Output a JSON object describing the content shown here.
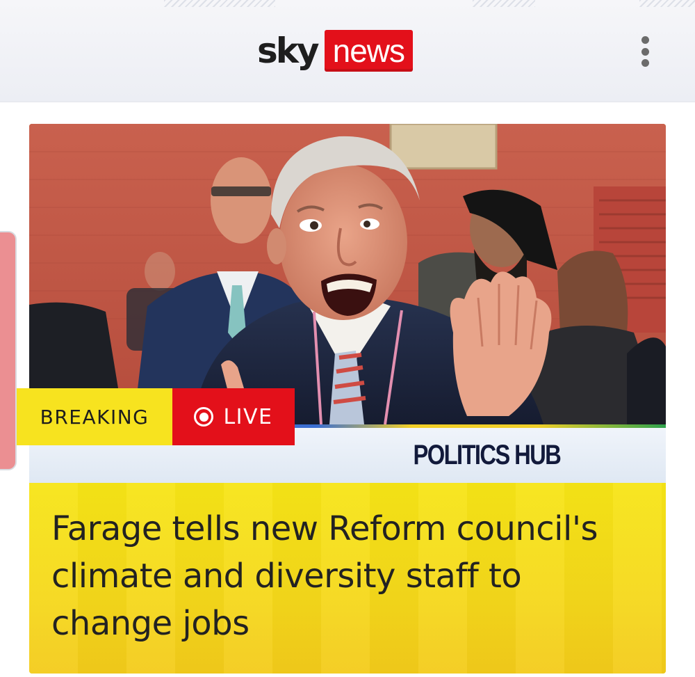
{
  "header": {
    "logo_sky": "sky",
    "logo_news": "news",
    "menu_icon": "more-vertical-icon"
  },
  "article_card": {
    "badge_breaking": "BREAKING",
    "badge_live": "LIVE",
    "live_icon": "live-record-icon",
    "hub_label": "POLITICS HUB",
    "headline": "Farage tells new Reform council's climate and diversity staff to change jobs"
  },
  "colors": {
    "sky_red": "#e3101a",
    "breaking_yellow": "#f7e31f",
    "hub_navy": "#121a3b",
    "headline_yellow": "#f5d81a"
  }
}
